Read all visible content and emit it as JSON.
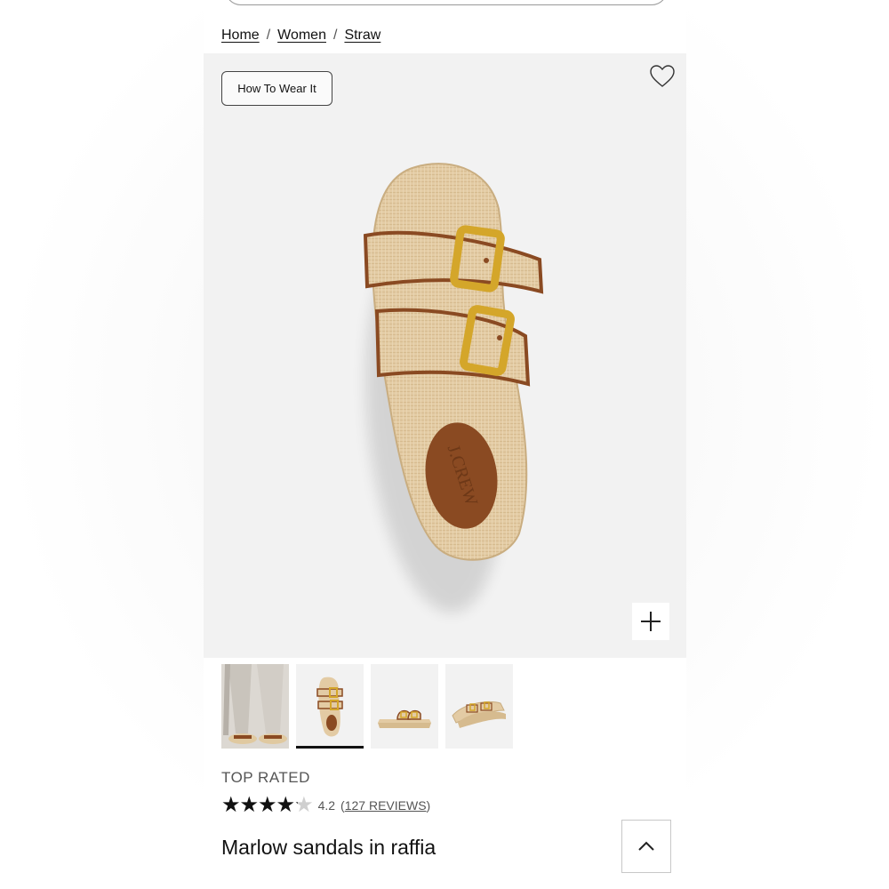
{
  "breadcrumb": {
    "items": [
      "Home",
      "Women",
      "Straw"
    ],
    "separator": "/"
  },
  "gallery": {
    "how_to_wear_label": "How To Wear It",
    "heart_icon": "heart-outline-icon",
    "zoom_icon": "plus-icon",
    "thumbnails": [
      {
        "name": "model-wearing-sandals",
        "active": false
      },
      {
        "name": "sandal-top-view",
        "active": true
      },
      {
        "name": "sandal-side-view",
        "active": false
      },
      {
        "name": "sandal-pair-angle-view",
        "active": false
      }
    ]
  },
  "product": {
    "badge": "TOP RATED",
    "rating": 4.2,
    "rating_max": 5,
    "rating_text": "4.2",
    "reviews_open": "(",
    "reviews_link": "127 REVIEWS",
    "reviews_close": ")",
    "name": "Marlow sandals in raffia",
    "brand_emboss": "J.CREW"
  },
  "colors": {
    "raffia": "#e3cba4",
    "leather": "#8a4a22",
    "buckle": "#d4a62a",
    "image_bg": "#f2f2f2"
  },
  "scroll_top_icon": "chevron-up-icon"
}
